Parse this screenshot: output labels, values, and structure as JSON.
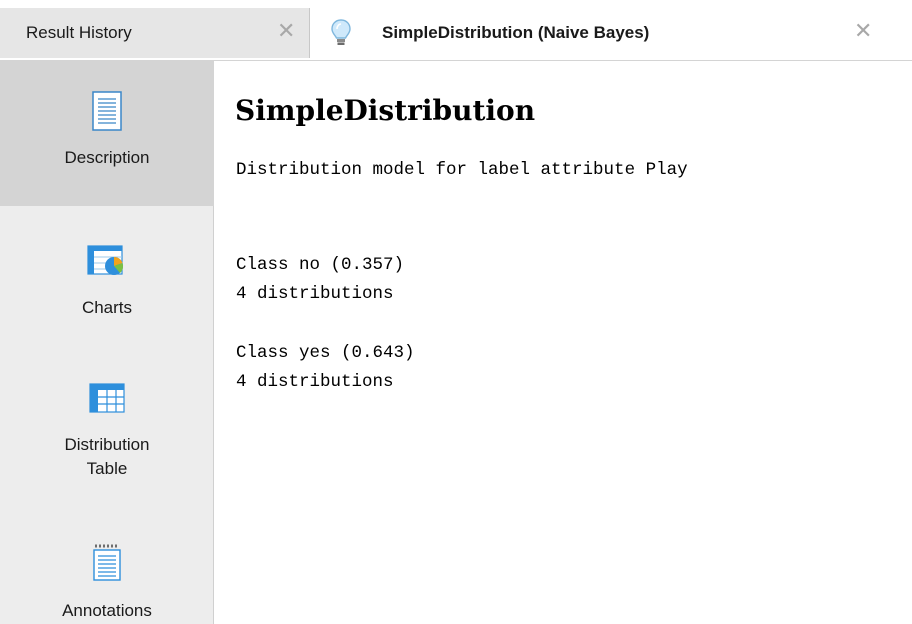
{
  "tabs": [
    {
      "label": "Result History",
      "active": false,
      "close_icon": "close-icon"
    },
    {
      "label": "SimpleDistribution (Naive Bayes)",
      "active": true,
      "icon": "lightbulb-icon",
      "close_icon": "close-icon"
    }
  ],
  "sidebar": {
    "items": [
      {
        "label": "Description",
        "icon": "document-icon",
        "selected": true
      },
      {
        "label": "Charts",
        "icon": "chart-icon",
        "selected": false
      },
      {
        "label_line1": "Distribution",
        "label_line2": "Table",
        "icon": "table-icon",
        "selected": false
      },
      {
        "label": "Annotations",
        "icon": "notes-icon",
        "selected": false
      }
    ]
  },
  "content": {
    "title": "SimpleDistribution",
    "description": "Distribution model for label attribute Play",
    "classes": [
      {
        "heading": "Class no (0.357)",
        "detail": "4 distributions"
      },
      {
        "heading": "Class yes (0.643)",
        "detail": "4 distributions"
      }
    ]
  },
  "colors": {
    "selected_sidebar": "#d4d4d4",
    "sidebar_background": "#ededed",
    "inactive_tab": "#e6e6e6",
    "icon_blue": "#2e8fdc"
  }
}
